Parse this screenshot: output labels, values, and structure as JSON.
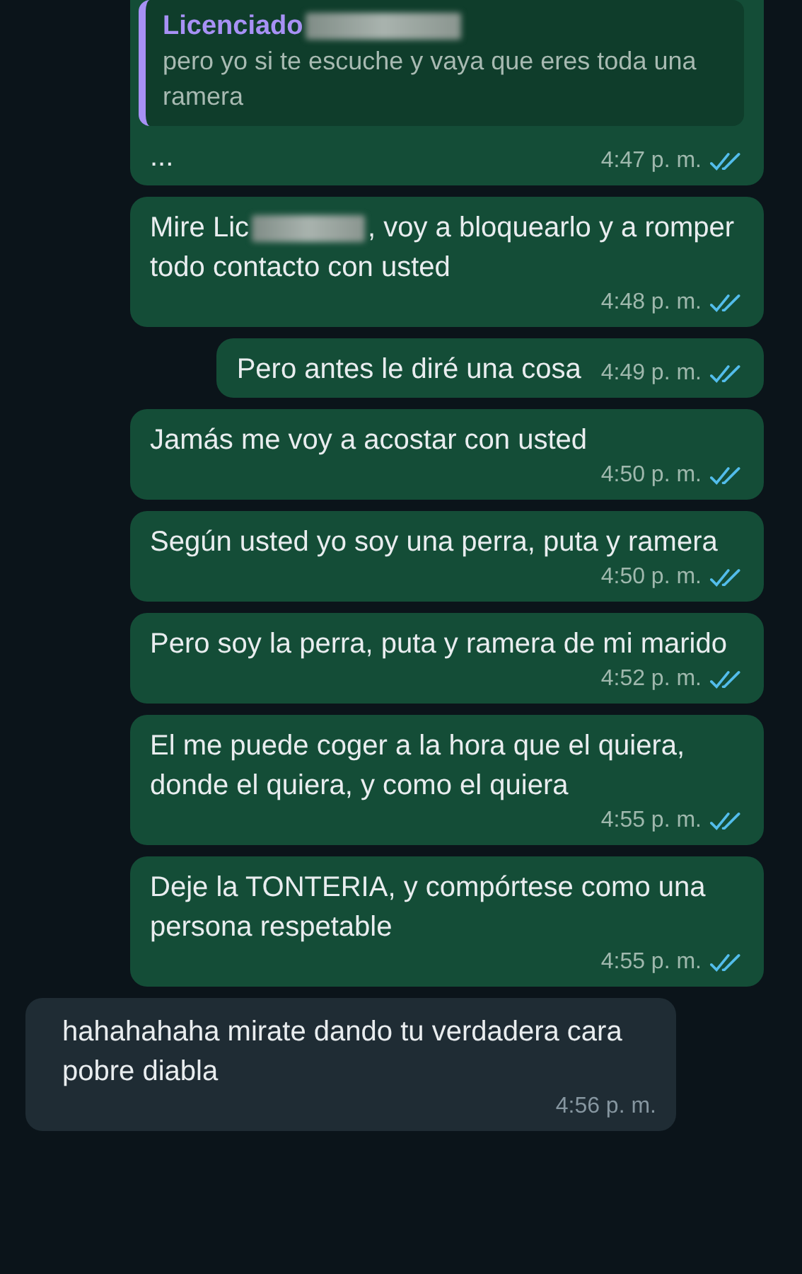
{
  "messages": [
    {
      "kind": "quote",
      "outgoing": true,
      "quote": {
        "author": "Licenciado",
        "author_redacted": true,
        "text": "pero yo si te escuche y vaya que eres toda una ramera"
      },
      "parts": [
        {
          "kind": "text",
          "text": "..."
        }
      ],
      "time": "4:47 p. m.",
      "read": true
    },
    {
      "kind": "text",
      "outgoing": true,
      "parts": [
        {
          "kind": "text",
          "text": "Mire Lic"
        },
        {
          "kind": "redacted"
        },
        {
          "kind": "text",
          "text": ", voy a bloquearlo y a romper todo contacto con usted"
        }
      ],
      "time": "4:48 p. m.",
      "read": true
    },
    {
      "kind": "text",
      "outgoing": true,
      "parts": [
        {
          "kind": "text",
          "text": "Pero antes le diré una cosa"
        }
      ],
      "time": "4:49 p. m.",
      "read": true
    },
    {
      "kind": "text",
      "outgoing": true,
      "parts": [
        {
          "kind": "text",
          "text": "Jamás me voy a acostar con usted"
        }
      ],
      "time": "4:50 p. m.",
      "read": true
    },
    {
      "kind": "text",
      "outgoing": true,
      "parts": [
        {
          "kind": "text",
          "text": "Según usted yo soy una perra, puta y ramera"
        }
      ],
      "time": "4:50 p. m.",
      "read": true
    },
    {
      "kind": "text",
      "outgoing": true,
      "parts": [
        {
          "kind": "text",
          "text": "Pero soy la perra, puta y ramera de mi marido"
        }
      ],
      "time": "4:52 p. m.",
      "read": true
    },
    {
      "kind": "text",
      "outgoing": true,
      "parts": [
        {
          "kind": "text",
          "text": "El me puede coger a la hora que el quiera, donde el quiera, y como el quiera"
        }
      ],
      "time": "4:55 p. m.",
      "read": true
    },
    {
      "kind": "text",
      "outgoing": true,
      "parts": [
        {
          "kind": "text",
          "text": "Deje la TONTERIA, y compórtese como una persona respetable"
        }
      ],
      "time": "4:55 p. m.",
      "read": true
    },
    {
      "kind": "text",
      "outgoing": false,
      "parts": [
        {
          "kind": "text",
          "text": "hahahahaha mirate dando tu verdadera cara pobre diabla"
        }
      ],
      "time": "4:56 p. m."
    }
  ]
}
